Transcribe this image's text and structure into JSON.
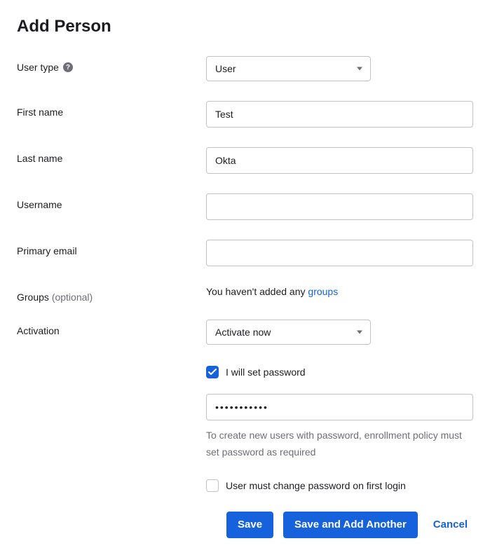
{
  "title": "Add Person",
  "labels": {
    "user_type": "User type",
    "first_name": "First name",
    "last_name": "Last name",
    "username": "Username",
    "primary_email": "Primary email",
    "groups": "Groups",
    "groups_optional": "(optional)",
    "activation": "Activation"
  },
  "fields": {
    "user_type": {
      "value": "User"
    },
    "first_name": {
      "value": "Test"
    },
    "last_name": {
      "value": "Okta"
    },
    "username": {
      "value": ""
    },
    "primary_email": {
      "value": ""
    },
    "activation": {
      "value": "Activate now"
    },
    "password": {
      "masked": "•••••••••••"
    }
  },
  "groups_message": {
    "prefix": "You haven't added any ",
    "link": "groups"
  },
  "checkboxes": {
    "set_password": {
      "label": "I will set password",
      "checked": true
    },
    "change_on_login": {
      "label": "User must change password on first login",
      "checked": false
    }
  },
  "helper": "To create new users with password, enrollment policy must set password as required",
  "buttons": {
    "save": "Save",
    "save_add_another": "Save and Add Another",
    "cancel": "Cancel"
  },
  "icons": {
    "help": "?"
  }
}
